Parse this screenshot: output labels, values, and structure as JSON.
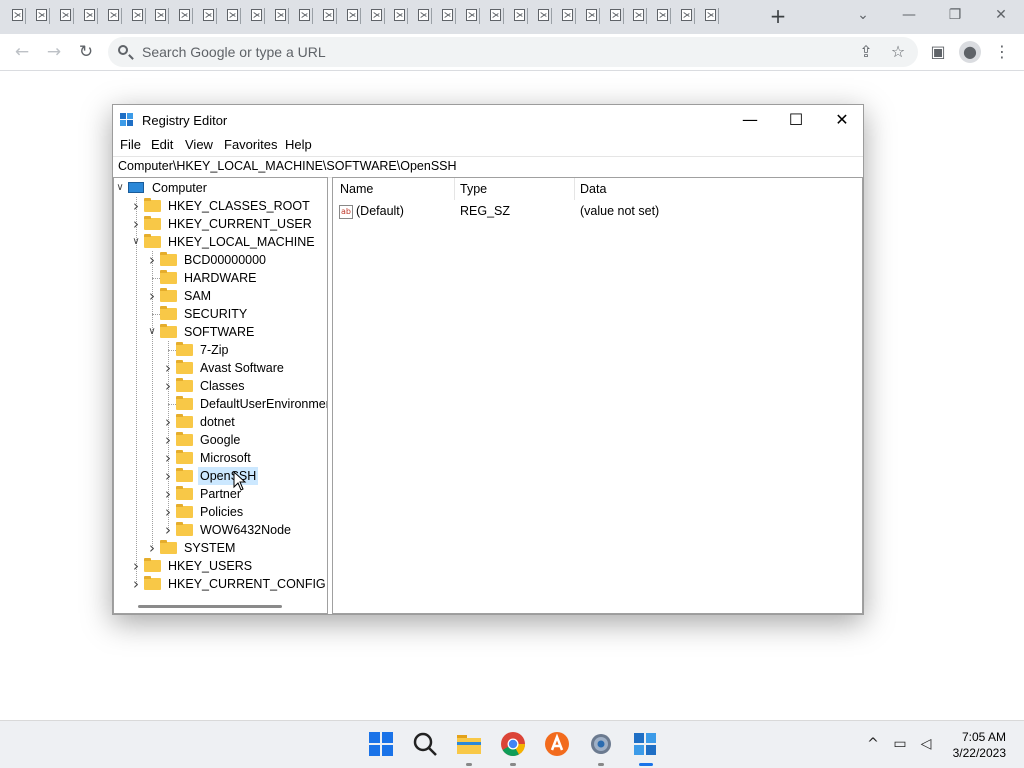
{
  "browser": {
    "tab_count": 30,
    "new_tab_label": "+",
    "omnibox_placeholder": "Search Google or type a URL"
  },
  "window": {
    "title": "Registry Editor",
    "menu": [
      "File",
      "Edit",
      "View",
      "Favorites",
      "Help"
    ],
    "address": "Computer\\HKEY_LOCAL_MACHINE\\SOFTWARE\\OpenSSH"
  },
  "tree": {
    "root": "Computer",
    "hives": [
      "HKEY_CLASSES_ROOT",
      "HKEY_CURRENT_USER",
      "HKEY_LOCAL_MACHINE"
    ],
    "hklm_children": [
      "BCD00000000",
      "HARDWARE",
      "SAM",
      "SECURITY",
      "SOFTWARE"
    ],
    "software_children": [
      "7-Zip",
      "Avast Software",
      "Classes",
      "DefaultUserEnvironment",
      "dotnet",
      "Google",
      "Microsoft",
      "OpenSSH",
      "Partner",
      "Policies",
      "WOW6432Node"
    ],
    "system": "SYSTEM",
    "hives_after": [
      "HKEY_USERS",
      "HKEY_CURRENT_CONFIG"
    ],
    "selected": "OpenSSH"
  },
  "list": {
    "columns": [
      "Name",
      "Type",
      "Data"
    ],
    "rows": [
      {
        "name": "(Default)",
        "type": "REG_SZ",
        "data": "(value not set)"
      }
    ]
  },
  "taskbar": {
    "time": "7:05 AM",
    "date": "3/22/2023"
  },
  "colors": {
    "tabstrip": "#dee1e6",
    "selection": "#cce8ff",
    "folder": "#f8c847",
    "taskbar": "#eef0f3"
  }
}
